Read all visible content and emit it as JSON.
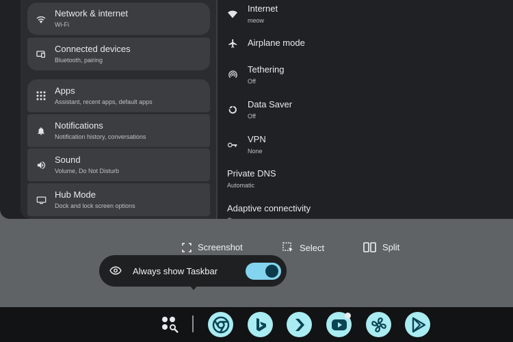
{
  "settings": {
    "left": [
      {
        "title": "Network & internet",
        "subtitle": "Wi-Fi",
        "icon": "wifi-icon"
      },
      {
        "title": "Connected devices",
        "subtitle": "Bluetooth, pairing",
        "icon": "devices-icon"
      },
      {
        "title": "Apps",
        "subtitle": "Assistant, recent apps, default apps",
        "icon": "apps-grid-icon"
      },
      {
        "title": "Notifications",
        "subtitle": "Notification history, conversations",
        "icon": "bell-icon"
      },
      {
        "title": "Sound",
        "subtitle": "Volume, Do Not Disturb",
        "icon": "volume-icon"
      },
      {
        "title": "Hub Mode",
        "subtitle": "Dock and lock screen options",
        "icon": "monitor-icon"
      }
    ],
    "right": [
      {
        "title": "Internet",
        "subtitle": "meow",
        "icon": "wifi-icon"
      },
      {
        "title": "Airplane mode",
        "subtitle": "",
        "icon": "airplane-icon"
      },
      {
        "title": "Tethering",
        "subtitle": "Off",
        "icon": "hotspot-icon"
      },
      {
        "title": "Data Saver",
        "subtitle": "Off",
        "icon": "data-saver-icon"
      },
      {
        "title": "VPN",
        "subtitle": "None",
        "icon": "vpn-key-icon"
      },
      {
        "title": "Private DNS",
        "subtitle": "Automatic",
        "icon": ""
      },
      {
        "title": "Adaptive connectivity",
        "subtitle": "On",
        "icon": ""
      }
    ]
  },
  "actions": {
    "screenshot": "Screenshot",
    "select": "Select",
    "split": "Split"
  },
  "popup": {
    "label": "Always show Taskbar",
    "toggle_on": true,
    "accent": "#83d4ee"
  },
  "taskbar": {
    "apps": [
      "app-launcher-icon",
      "chrome-icon",
      "bing-icon",
      "prime-video-icon",
      "youtube-icon",
      "fan-app-icon",
      "play-store-icon"
    ]
  }
}
